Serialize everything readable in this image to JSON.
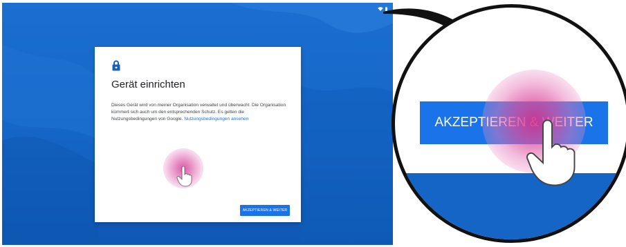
{
  "dialog": {
    "title": "Gerät einrichten",
    "body_text": "Dieses Gerät wird von meiner Organisation verwaltet und überwacht. Die Organisation kümmert sich auch um den entsprechenden Schutz. Es gelten die Nutzungsbedingungen von Google.",
    "terms_link": "Nutzungsbedingungen ansehen",
    "accept_button": "AKZEPTIEREN & WEITER"
  },
  "magnifier": {
    "accept_button": "AKZEPTIEREN & WEITER"
  },
  "icons": {
    "lock": "lock-icon",
    "wifi": "wifi-icon",
    "battery": "battery-icon",
    "hand": "hand-pointer-icon"
  },
  "colors": {
    "background_blue": "#1565c6",
    "button_blue": "#1a73e8",
    "link_blue": "#1a73e8",
    "touch_pink": "#d63c96",
    "lock_icon": "#1a5fb4"
  }
}
